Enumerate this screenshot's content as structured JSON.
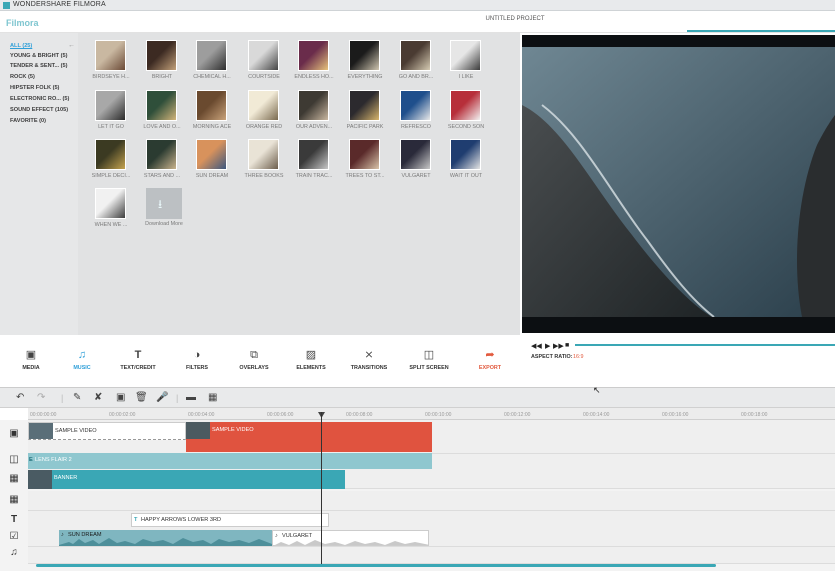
{
  "window": {
    "title": "WONDERSHARE FILMORA"
  },
  "header": {
    "brand": "Filmora",
    "project": "UNTITLED PROJECT"
  },
  "sidebar": {
    "categories": [
      {
        "label": "ALL (25)",
        "active": true
      },
      {
        "label": "YOUNG & BRIGHT (5)"
      },
      {
        "label": "TENDER & SENT... (5)"
      },
      {
        "label": "ROCK (5)"
      },
      {
        "label": "HIPSTER FOLK (5)"
      },
      {
        "label": "ELECTRONIC RO... (5)"
      },
      {
        "label": "SOUND EFFECT (105)"
      },
      {
        "label": "FAVORITE (0)"
      }
    ]
  },
  "library": {
    "items": [
      {
        "label": "BIRDSEYE H..."
      },
      {
        "label": "BRIGHT"
      },
      {
        "label": "CHEMICAL H..."
      },
      {
        "label": "COURTSIDE"
      },
      {
        "label": "ENDLESS HO..."
      },
      {
        "label": "EVERYTHING"
      },
      {
        "label": "GO AND BR..."
      },
      {
        "label": "I LIKE"
      },
      {
        "label": "LET IT GO"
      },
      {
        "label": "LOVE AND O..."
      },
      {
        "label": "MORNING ACE"
      },
      {
        "label": "ORANGE RED"
      },
      {
        "label": "OUR ADVEN..."
      },
      {
        "label": "PACIFIC PARK"
      },
      {
        "label": "REFRESCO"
      },
      {
        "label": "SECOND SON"
      },
      {
        "label": "SIMPLE DECI..."
      },
      {
        "label": "STARS AND ..."
      },
      {
        "label": "SUN DREAM"
      },
      {
        "label": "THREE BOOKS"
      },
      {
        "label": "TRAIN TRAC..."
      },
      {
        "label": "TREES TO ST..."
      },
      {
        "label": "VULGARET"
      },
      {
        "label": "WAIT IT OUT"
      },
      {
        "label": "WHEN WE ..."
      }
    ],
    "download_more": "Download More"
  },
  "preview": {
    "aspect_label": "ASPECT RATIO:",
    "aspect_value": "16:9"
  },
  "toolbar": {
    "items": [
      {
        "label": "MEDIA",
        "icon": "media-icon"
      },
      {
        "label": "MUSIC",
        "icon": "music-icon",
        "active": true
      },
      {
        "label": "TEXT/CREDIT",
        "icon": "text-icon"
      },
      {
        "label": "FILTERS",
        "icon": "filters-icon"
      },
      {
        "label": "OVERLAYS",
        "icon": "overlays-icon"
      },
      {
        "label": "ELEMENTS",
        "icon": "elements-icon"
      },
      {
        "label": "TRANSITIONS",
        "icon": "transitions-icon"
      },
      {
        "label": "SPLIT SCREEN",
        "icon": "split-screen-icon"
      },
      {
        "label": "EXPORT",
        "icon": "export-icon",
        "accent": true
      }
    ]
  },
  "ruler": {
    "ticks": [
      "00:00:00:00",
      "00:00:02:00",
      "00:00:04:00",
      "00:00:06:00",
      "00:00:08:00",
      "00:00:10:00",
      "00:00:12:00",
      "00:00:14:00",
      "00:00:16:00",
      "00:00:18:00"
    ]
  },
  "timeline": {
    "clips": {
      "video1": "SAMPLE VIDEO",
      "video2": "SAMPLE VIDEO",
      "effect": "LENS FLAIR 2",
      "overlay": "BANNER",
      "text": "HAPPY ARROWS LOWER 3RD",
      "audio1": "SUN DREAM",
      "audio2": "VULGARET"
    }
  },
  "colors": {
    "accent": "#3aa7b5",
    "export": "#e25a3e",
    "video_clip_selected": "#e0533f",
    "music_active": "#2f9fd8"
  }
}
